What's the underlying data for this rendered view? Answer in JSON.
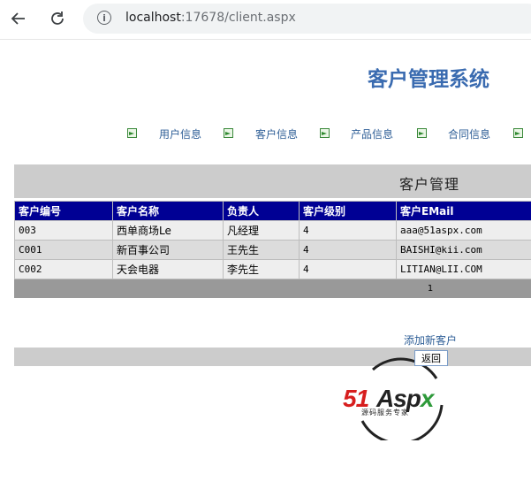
{
  "browser": {
    "url_host": "localhost",
    "url_rest": ":17678/client.aspx"
  },
  "page": {
    "title": "客户管理系统",
    "nav": [
      "用户信息",
      "客户信息",
      "产品信息",
      "合同信息"
    ],
    "section_title": "客户管理",
    "add_link": "添加新客户",
    "back_button": "返回"
  },
  "table": {
    "headers": [
      "客户编号",
      "客户名称",
      "负责人",
      "客户级别",
      "客户EMail"
    ],
    "rows": [
      [
        "003",
        "西单商场Le",
        "凡经理",
        "4",
        "aaa@51aspx.com"
      ],
      [
        "C001",
        "新百事公司",
        "王先生",
        "4",
        "BAISHI@kii.com"
      ],
      [
        "C002",
        "天会电器",
        "李先生",
        "4",
        "LITIAN@LII.COM"
      ]
    ],
    "pager": "1"
  },
  "logo": {
    "brand_51": "51",
    "brand_asp": "Asp",
    "brand_x": "x",
    "tagline": "源码服务专家"
  },
  "colors": {
    "title": "#3a6bb0",
    "header_bg": "#000094",
    "link": "#2f5f97",
    "logo_red": "#d71e1e",
    "logo_green": "#2e9a3a"
  }
}
